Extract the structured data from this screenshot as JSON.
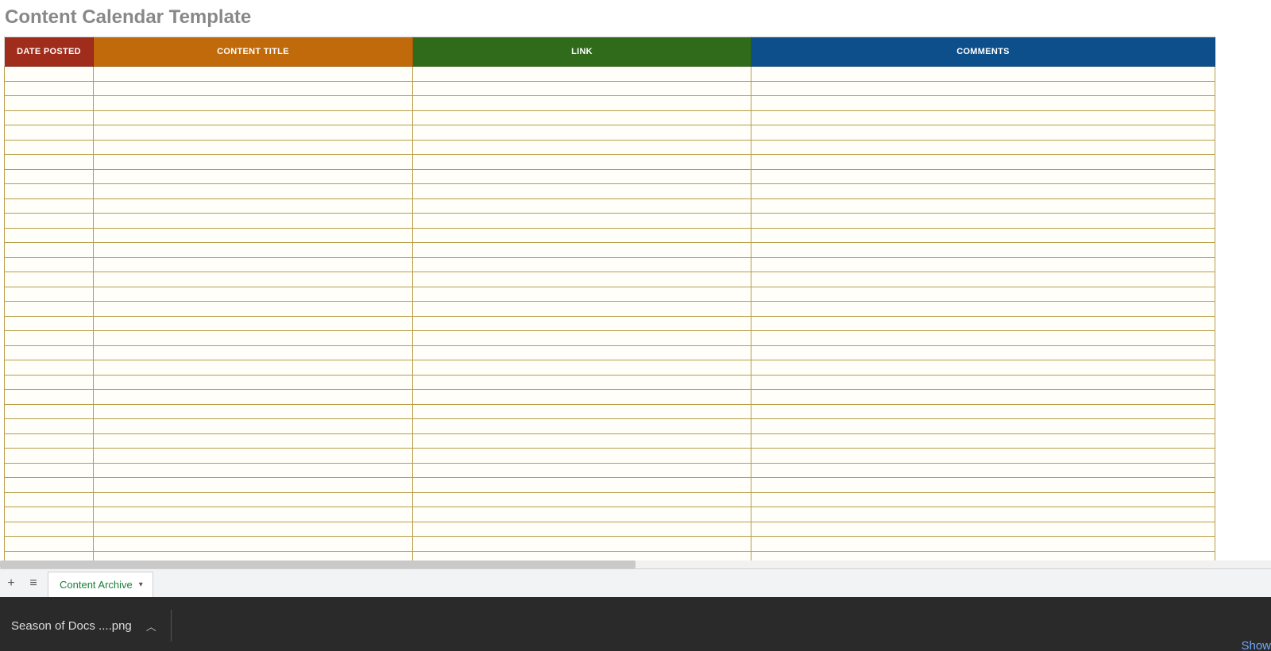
{
  "title": "Content Calendar Template",
  "columns": [
    {
      "label": "DATE POSTED",
      "class": "hdr-date",
      "wclass": "col-date"
    },
    {
      "label": "CONTENT TITLE",
      "class": "hdr-title",
      "wclass": "col-title"
    },
    {
      "label": "LINK",
      "class": "hdr-link",
      "wclass": "col-link"
    },
    {
      "label": "COMMENTS",
      "class": "hdr-comm",
      "wclass": "col-comm"
    }
  ],
  "row_count": 34,
  "sheet_bar": {
    "add_icon": "+",
    "menu_icon": "≡",
    "active_tab": "Content Archive"
  },
  "download_bar": {
    "filename": "Season of Docs ....png",
    "showall": "Show"
  }
}
